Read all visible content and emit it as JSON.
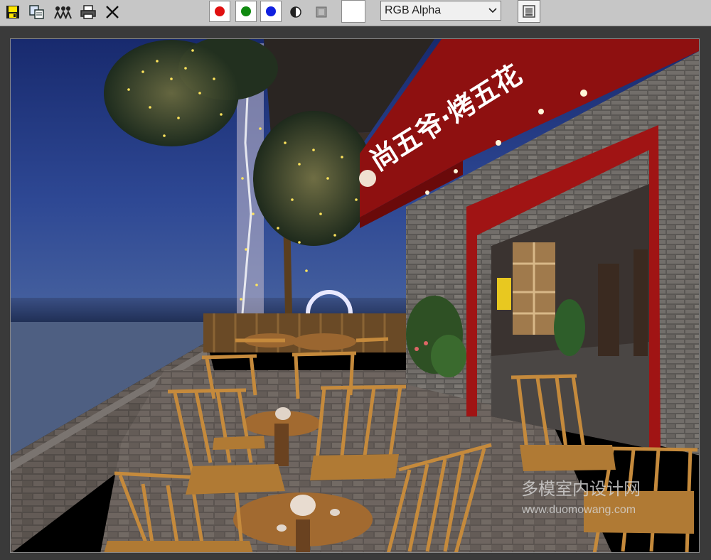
{
  "toolbar": {
    "tools": [
      {
        "name": "save-image-icon"
      },
      {
        "name": "clone-window-icon"
      },
      {
        "name": "print-icon"
      },
      {
        "name": "clear-icon"
      }
    ],
    "channels": [
      {
        "name": "red-channel",
        "color": "#e01010"
      },
      {
        "name": "green-channel",
        "color": "#108a10"
      },
      {
        "name": "blue-channel",
        "color": "#1020e0"
      }
    ],
    "display_mode": "RGB Alpha",
    "swatch_color": "#ffffff"
  },
  "render": {
    "sign_text": "尚五爷·烤五花",
    "watermark_cn": "多模室内设计网",
    "watermark_url": "www.duomowang.com"
  }
}
